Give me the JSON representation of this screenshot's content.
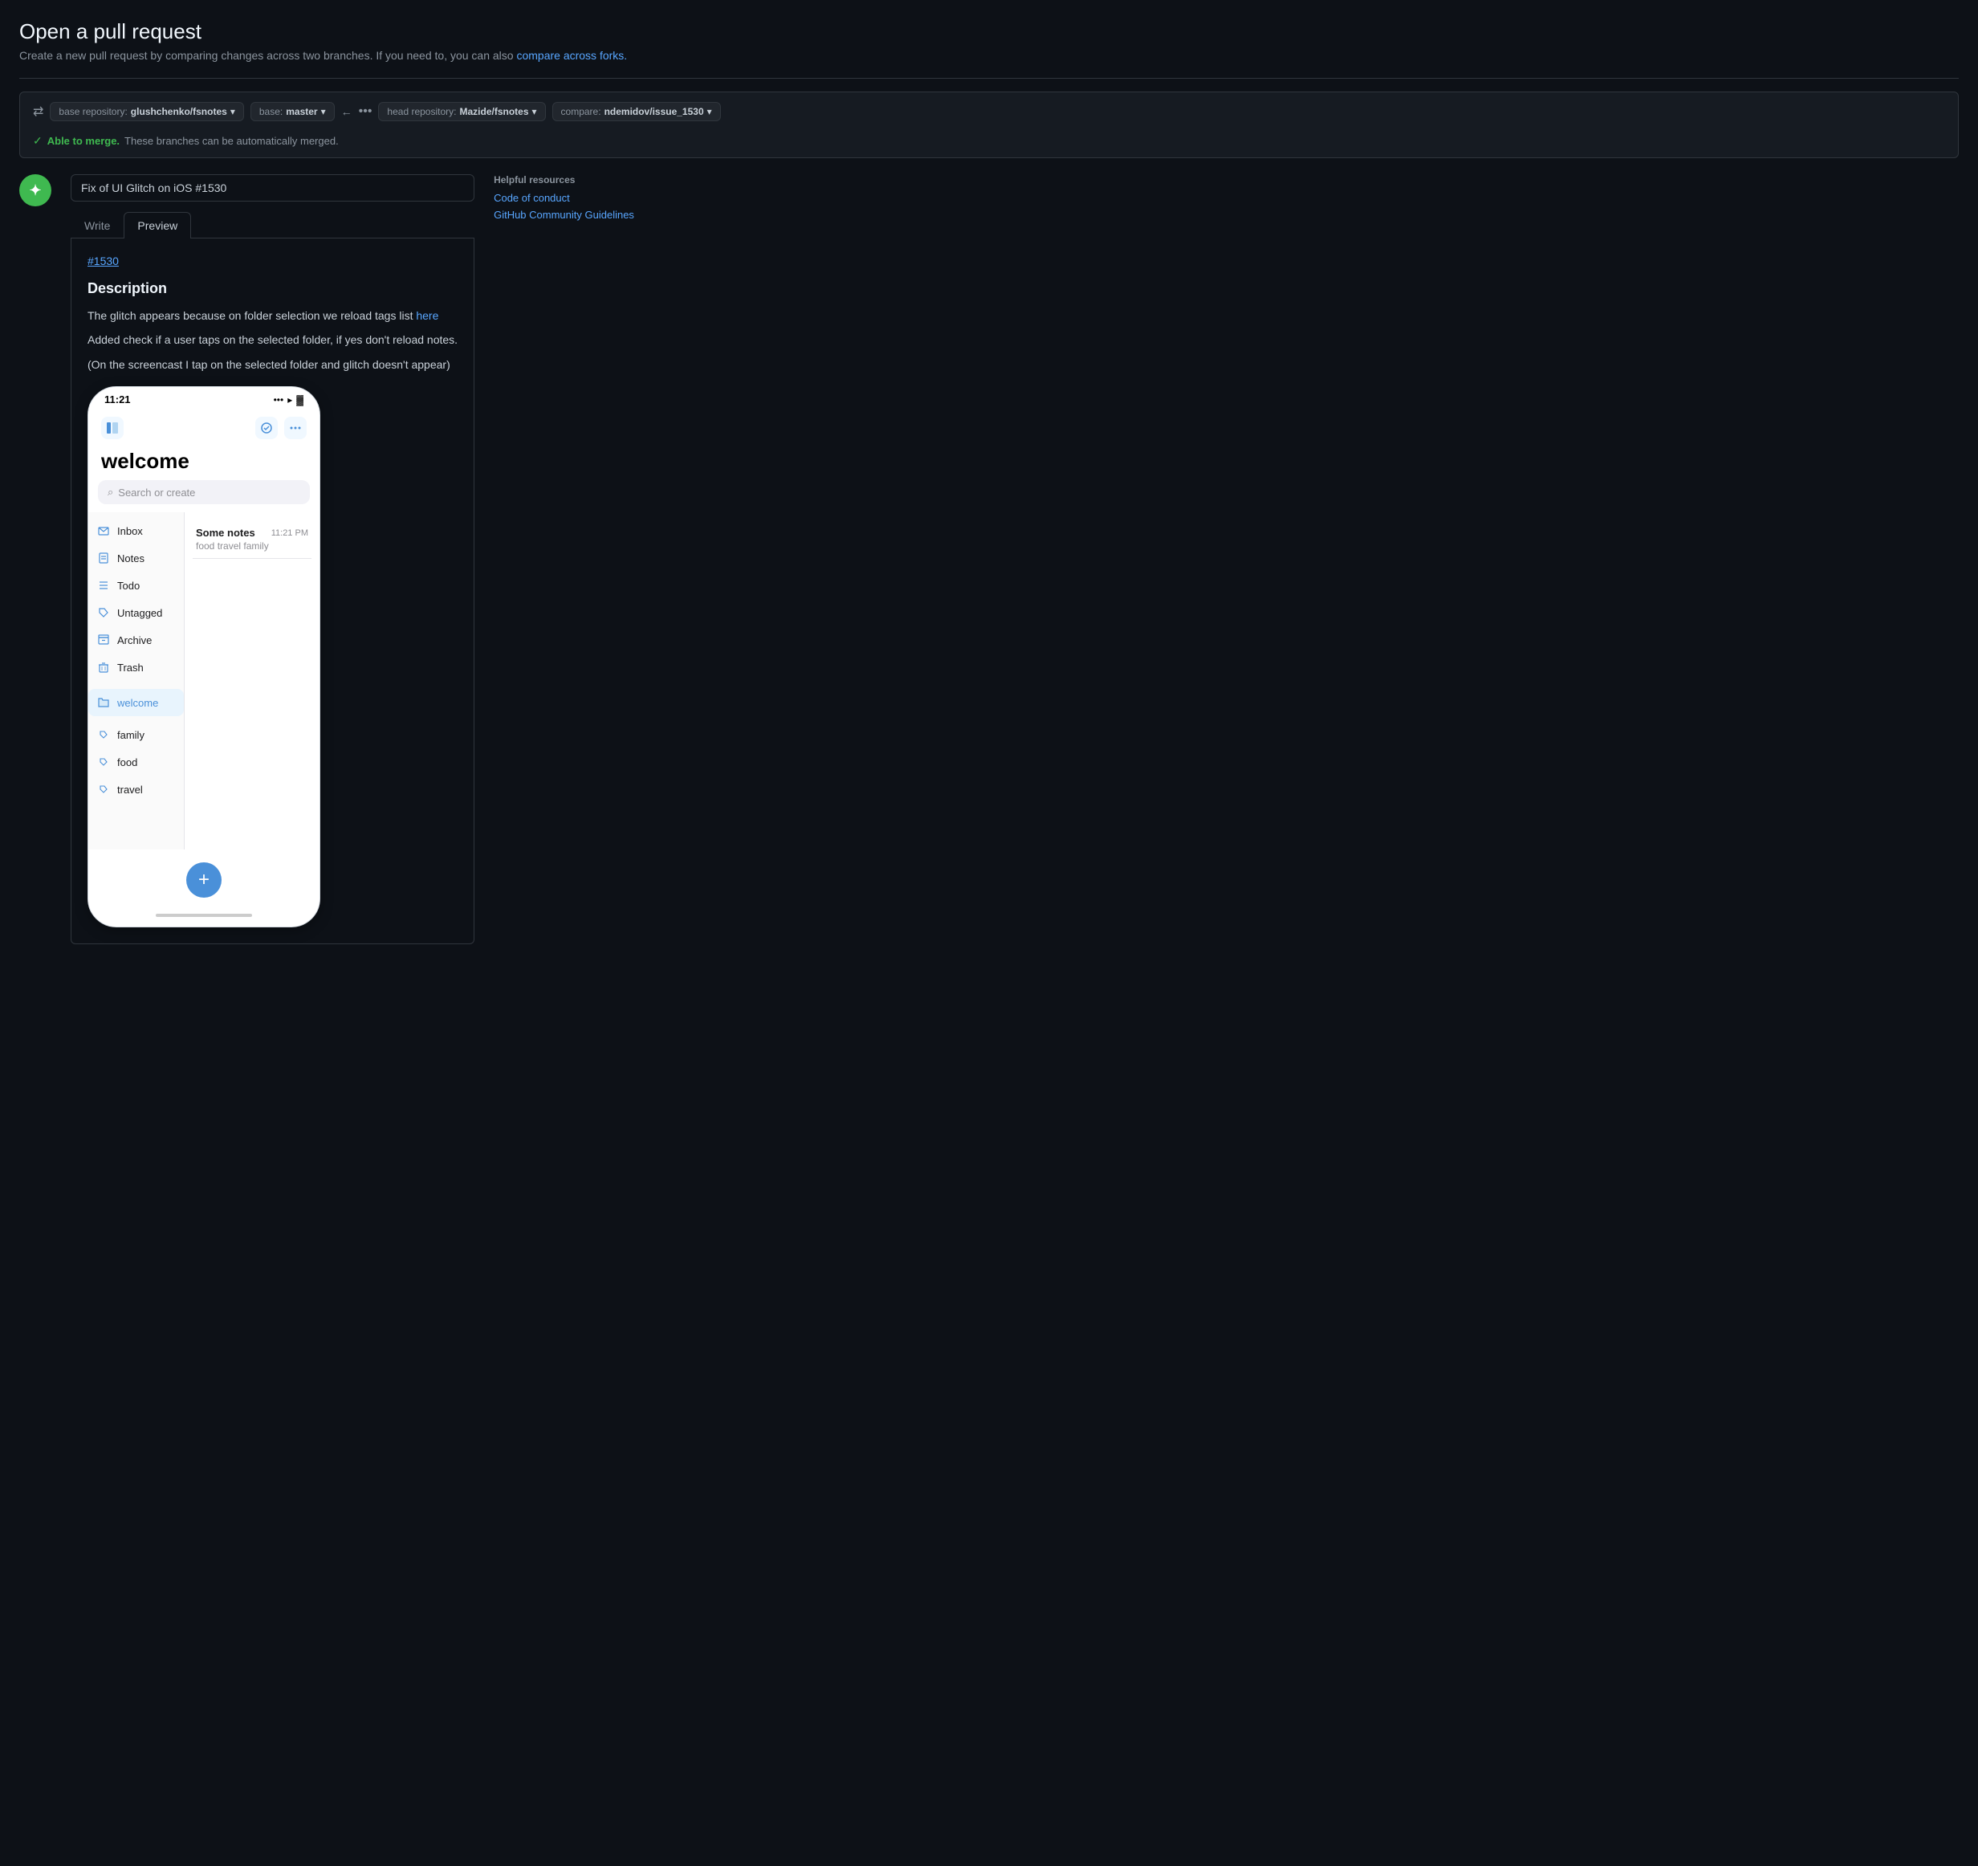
{
  "page": {
    "title": "Open a pull request",
    "subtitle": "Create a new pull request by comparing changes across two branches. If you need to, you can also",
    "subtitle_link": "compare across forks.",
    "merge_status": "Able to merge.",
    "merge_status_detail": "These branches can be automatically merged."
  },
  "branch_bar": {
    "base_repo_label": "base repository:",
    "base_repo_value": "glushchenko/fsnotes",
    "base_label": "base:",
    "base_value": "master",
    "head_repo_label": "head repository:",
    "head_repo_value": "Mazide/fsnotes",
    "compare_label": "compare:",
    "compare_value": "ndemidov/issue_1530"
  },
  "pr_form": {
    "title_value": "Fix of UI Glitch on iOS #1530",
    "tab_write": "Write",
    "tab_preview": "Preview",
    "issue_ref": "#1530",
    "description_heading": "Description",
    "description_line1": "The glitch appears because on folder selection we reload tags list",
    "description_link_text": "here",
    "description_line2": "Added check if a user taps on the selected folder, if yes don't reload notes.",
    "description_line3": "(On the screencast I tap on the selected folder and glitch doesn't appear)"
  },
  "phone": {
    "time": "11:21",
    "app_title": "welcome",
    "search_placeholder": "Search or create",
    "sidebar_items": [
      {
        "label": "Inbox",
        "icon": "📥"
      },
      {
        "label": "Notes",
        "icon": "📝"
      },
      {
        "label": "Todo",
        "icon": "☰"
      },
      {
        "label": "Untagged",
        "icon": "🏷"
      },
      {
        "label": "Archive",
        "icon": "📦"
      },
      {
        "label": "Trash",
        "icon": "🗑"
      }
    ],
    "folders": [
      {
        "label": "welcome",
        "icon": "📁",
        "selected": true
      }
    ],
    "tags": [
      {
        "label": "family"
      },
      {
        "label": "food"
      },
      {
        "label": "travel"
      }
    ],
    "notes": [
      {
        "title": "Some notes",
        "time": "11:21 PM",
        "preview": "food travel family"
      }
    ],
    "fab_label": "+"
  },
  "sidebar": {
    "helpful_resources_title": "Helpful resources",
    "links": [
      {
        "label": "Code of conduct",
        "url": "#"
      },
      {
        "label": "GitHub Community Guidelines",
        "url": "#"
      }
    ]
  }
}
